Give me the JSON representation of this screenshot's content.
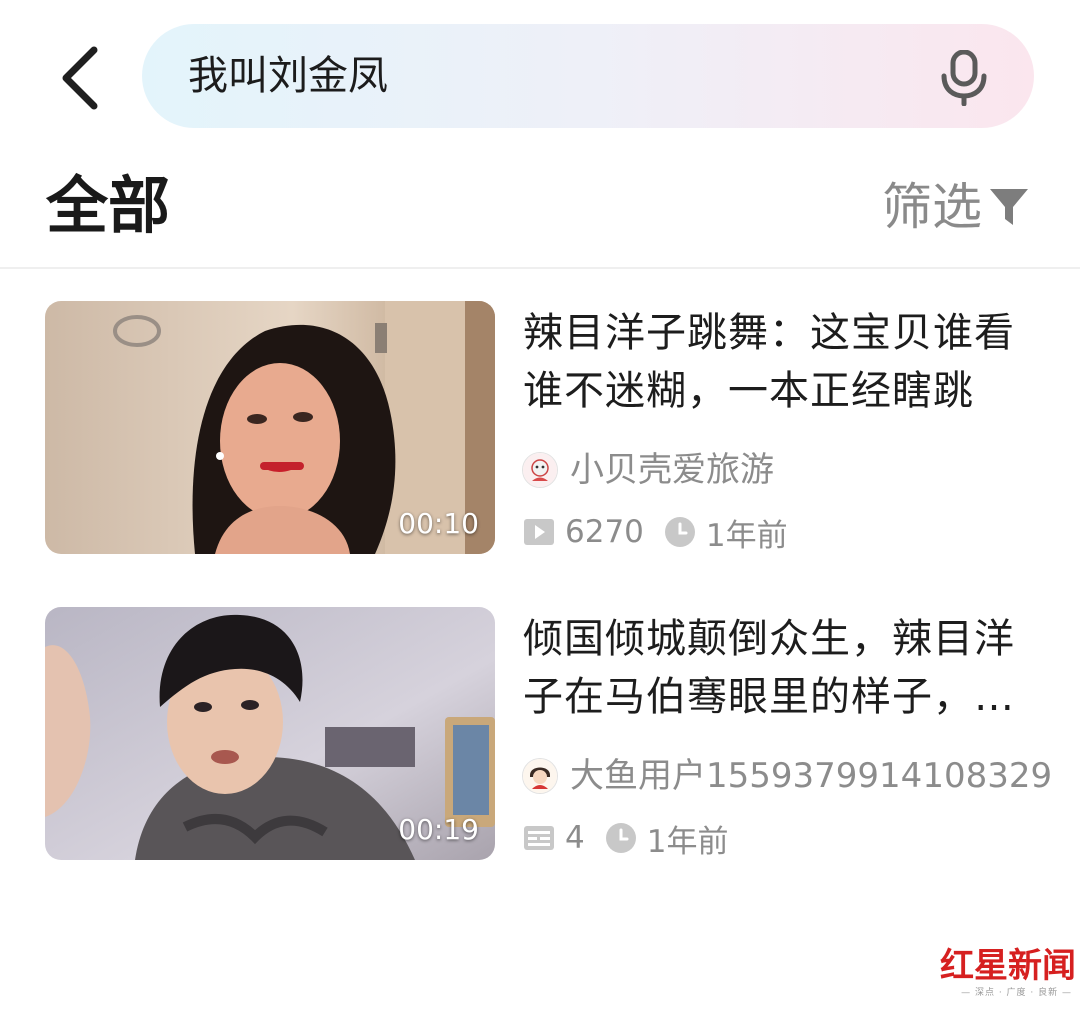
{
  "search": {
    "query": "我叫刘金凤"
  },
  "header": {
    "tab_all": "全部",
    "filter_label": "筛选"
  },
  "results": [
    {
      "title": "辣目洋子跳舞：这宝贝谁看谁不迷糊，一本正经瞎跳",
      "duration": "00:10",
      "author": "小贝壳爱旅游",
      "count": "6270",
      "count_icon": "play-icon",
      "time": "1年前"
    },
    {
      "title": "倾国倾城颠倒众生，辣目洋子在马伯骞眼里的样子，…",
      "duration": "00:19",
      "author": "大鱼用户1559379914108329",
      "count": "4",
      "count_icon": "article-icon",
      "time": "1年前"
    }
  ],
  "watermark": {
    "brand": "红星新闻",
    "tagline": "— 深点 · 广度 · 良新 —"
  },
  "colors": {
    "search_gradient_start": "#e3f4fb",
    "search_gradient_end": "#fbe6ee",
    "secondary_text": "#8c8c8c",
    "watermark_red": "#d62020"
  }
}
